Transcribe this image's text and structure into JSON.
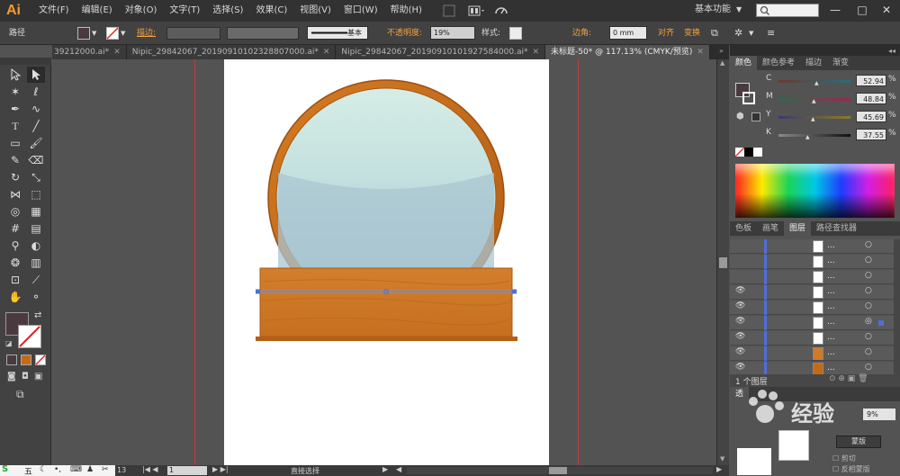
{
  "app": {
    "logo": "Ai"
  },
  "menu": [
    "文件(F)",
    "编辑(E)",
    "对象(O)",
    "文字(T)",
    "选择(S)",
    "效果(C)",
    "视图(V)",
    "窗口(W)",
    "帮助(H)"
  ],
  "workspace": {
    "label": "基本功能"
  },
  "window_controls": {
    "minimize": "—",
    "maximize": "□",
    "close": "✕"
  },
  "control_bar": {
    "selection_label": "路径",
    "stroke_label": "描边:",
    "stroke_style": "基本",
    "opacity_label": "不透明度:",
    "opacity_value": "19%",
    "style_label": "样式:",
    "corner_label": "边角:",
    "corner_value": "0 mm",
    "align_label": "对齐",
    "transform_label": "变换"
  },
  "tabs": [
    {
      "label": "39212000.ai*",
      "active": false
    },
    {
      "label": "Nipic_29842067_20190910102328807000.ai*",
      "active": false
    },
    {
      "label": "Nipic_29842067_20190910101927584000.ai*",
      "active": false
    },
    {
      "label": "未标题-50* @ 117.13% (CMYK/预览)",
      "active": true
    }
  ],
  "statusbar": {
    "zoom": "13",
    "page": "1",
    "tool": "直接选择"
  },
  "color_panel": {
    "tabs": [
      "颜色",
      "颜色参考",
      "描边",
      "渐变"
    ],
    "sliders": [
      {
        "label": "C",
        "value": "52.94"
      },
      {
        "label": "M",
        "value": "48.84"
      },
      {
        "label": "Y",
        "value": "45.69"
      },
      {
        "label": "K",
        "value": "37.55"
      }
    ]
  },
  "layers_panel": {
    "tabs": [
      "色板",
      "画笔",
      "图层",
      "路径查找器"
    ],
    "footer": "1 个图层",
    "rows": 9
  },
  "lower_panel": {
    "title": "透",
    "labels": [
      "剪切",
      "反相蒙版"
    ],
    "button": "蒙版",
    "percent": "9%"
  },
  "watermark": {
    "text": "经验"
  },
  "ime_bar": {
    "label": "五"
  },
  "colors": {
    "frame": "#c46a17",
    "glass_top": "#cde8e2",
    "glass_bottom": "#8fb3c3",
    "base_wood": "#d07b2a",
    "base_dark": "#b85f18",
    "fill_swatch": "#4a3a40",
    "selection": "#4d6fd8"
  }
}
